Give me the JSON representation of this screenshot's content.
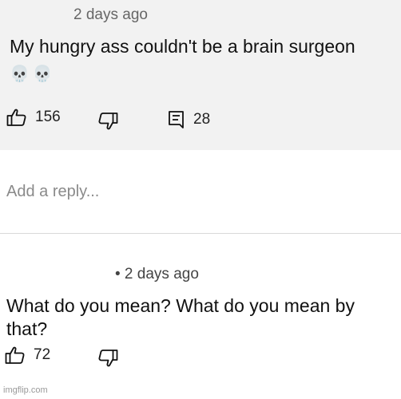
{
  "comment1": {
    "timestamp": "2 days ago",
    "text": "My hungry ass couldn't be a brain surgeon",
    "emoji": "💀💀",
    "likes": "156",
    "replies": "28"
  },
  "reply_input": {
    "placeholder": "Add a reply..."
  },
  "comment2": {
    "timestamp": "• 2 days ago",
    "text_line1": "What do you mean? What do you mean by",
    "text_line2": "that?",
    "likes": "72"
  },
  "watermark": "imgflip.com"
}
